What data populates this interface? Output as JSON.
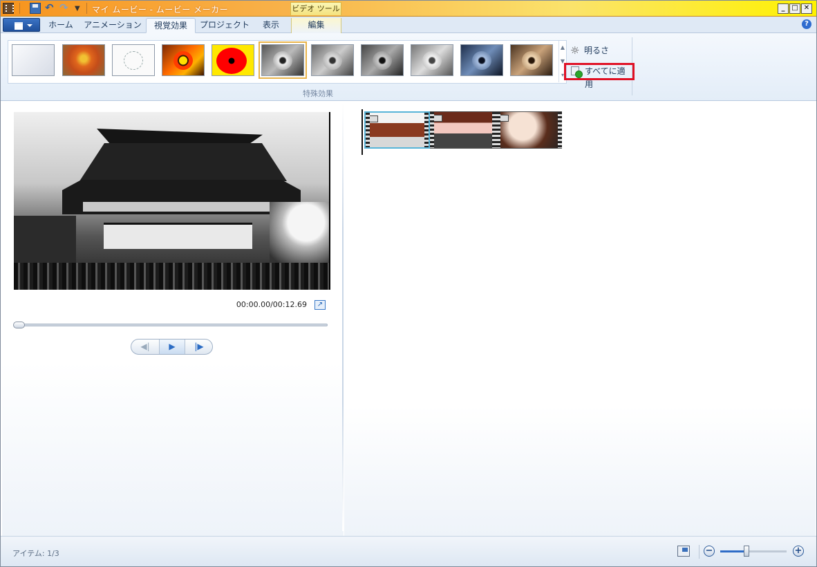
{
  "window": {
    "title": "マイ ムービー - ムービー メーカー",
    "contextual_tab_group": "ビデオ ツール"
  },
  "tabs": [
    {
      "label": "ホーム"
    },
    {
      "label": "アニメーション"
    },
    {
      "label": "視覚効果",
      "active": true
    },
    {
      "label": "プロジェクト"
    },
    {
      "label": "表示"
    },
    {
      "label": "編集"
    }
  ],
  "ribbon": {
    "group_label": "特殊効果",
    "brightness_label": "明るさ",
    "apply_all_label": "すべてに適用",
    "effects": [
      {
        "name": "none",
        "style": "none"
      },
      {
        "name": "blur",
        "style": "blur"
      },
      {
        "name": "edge-detection",
        "style": "edge"
      },
      {
        "name": "posterize",
        "style": "posterize"
      },
      {
        "name": "threshold",
        "style": "threshold"
      },
      {
        "name": "black-and-white",
        "style": "bw",
        "selected": true
      },
      {
        "name": "black-and-white-orange",
        "style": "bw2"
      },
      {
        "name": "black-and-white-yellow",
        "style": "bw3"
      },
      {
        "name": "black-and-white-red",
        "style": "bw4"
      },
      {
        "name": "cyanotype",
        "style": "cyan"
      },
      {
        "name": "sepia",
        "style": "sepia"
      }
    ]
  },
  "preview": {
    "timecode": "00:00.00/00:12.69",
    "seek_position": 0
  },
  "storyboard": {
    "clip_count": 3,
    "selected_clip": 1
  },
  "status": {
    "item_count": "アイテム: 1/3",
    "zoom_level": 0.4
  },
  "colors": {
    "title_gradient_start": "#f7941d",
    "title_gradient_end": "#fff200",
    "highlight_box": "#e01024",
    "selected_effect_outline": "#e8b34a",
    "selected_clip_border": "#58b4d8"
  },
  "icons": {
    "app": "film-icon",
    "save": "save-icon",
    "undo": "undo-icon",
    "redo": "redo-icon",
    "brightness": "sun-icon",
    "apply_all": "apply-all-icon",
    "help": "help-icon",
    "fullscreen": "fullscreen-icon",
    "thumbnail_size": "thumbnail-size-icon"
  }
}
